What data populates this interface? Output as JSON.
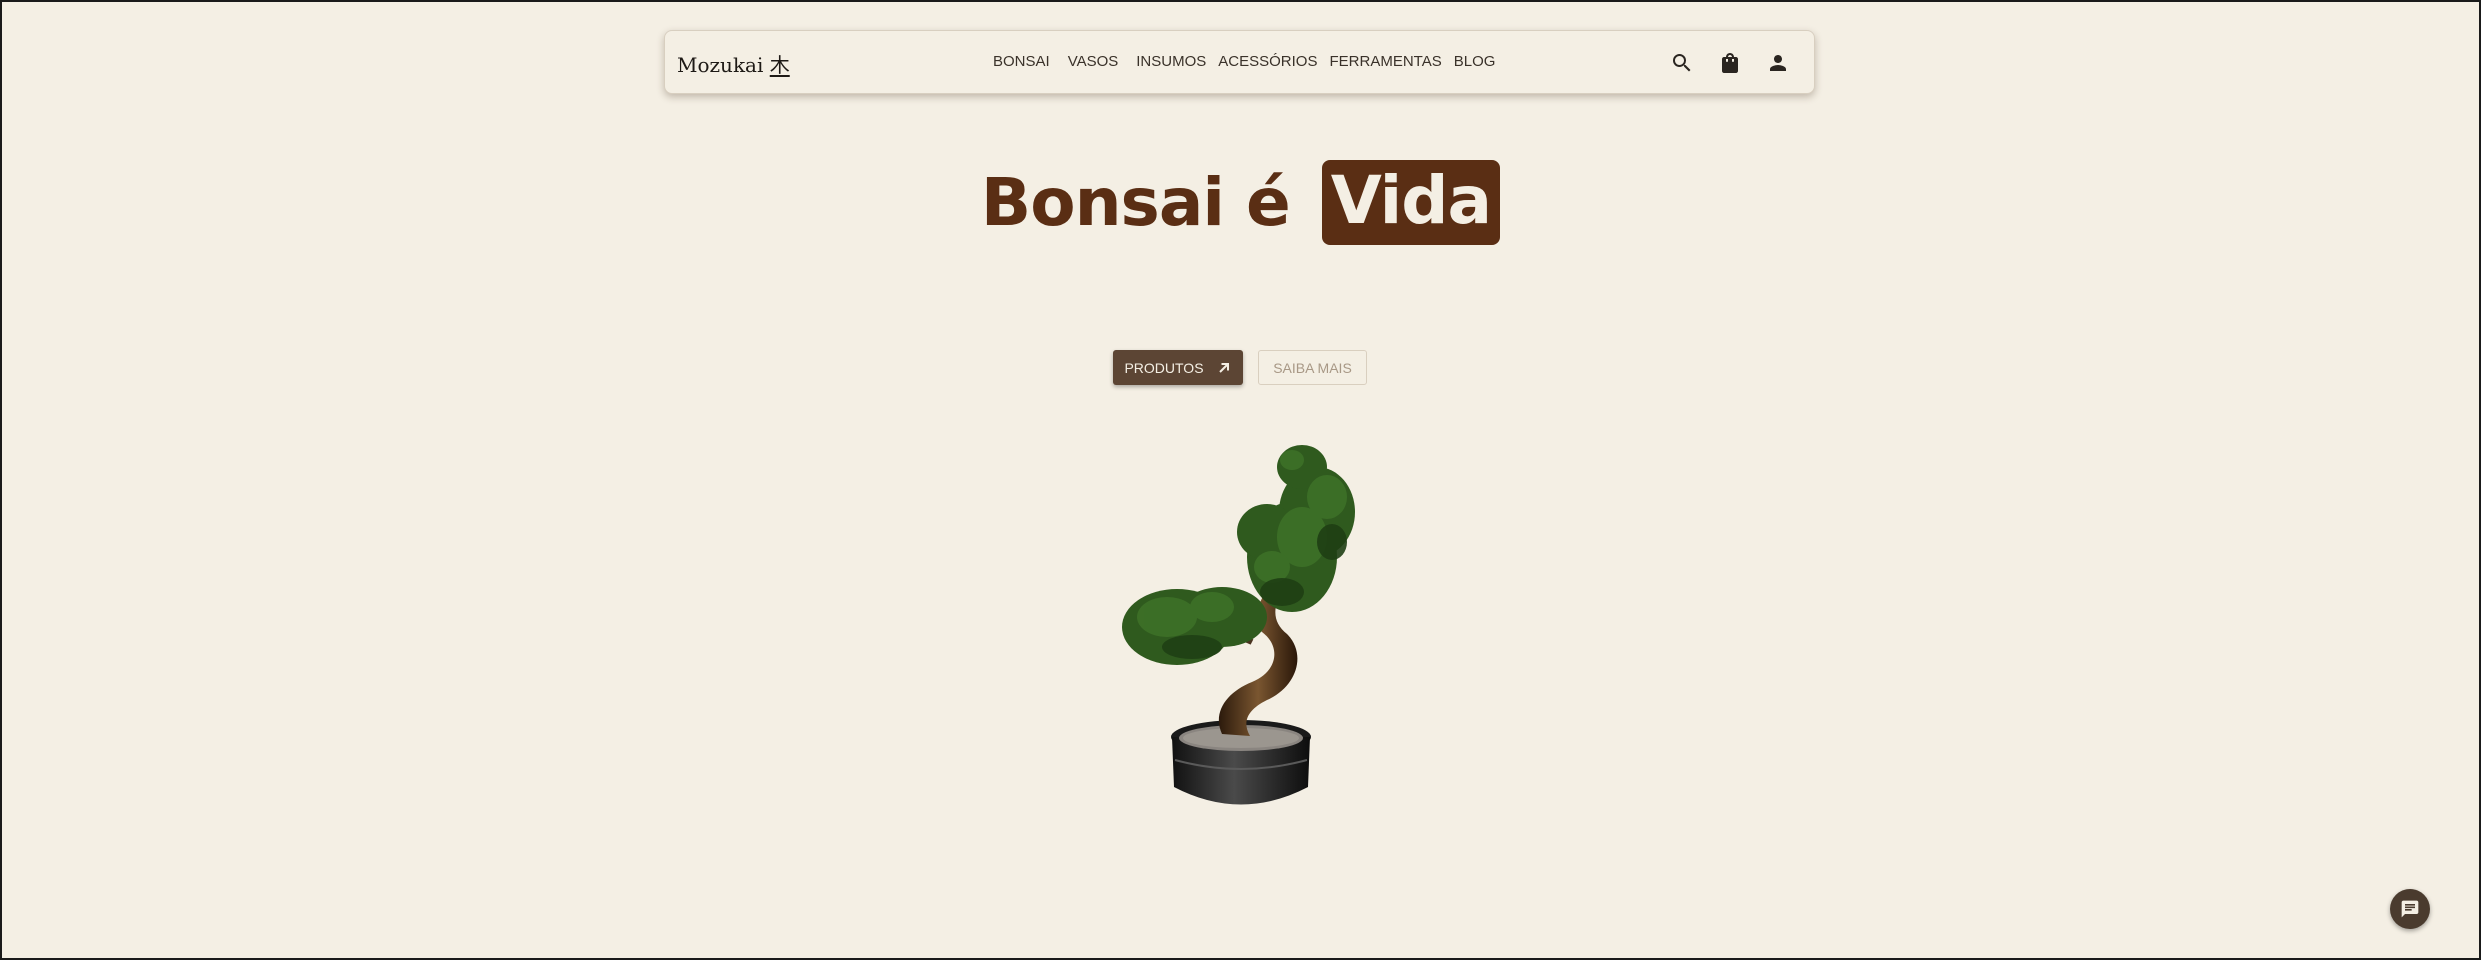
{
  "brand": {
    "name": "Mozukai",
    "kanji": "木"
  },
  "nav": {
    "links": [
      "BONSAI",
      "VASOS",
      "INSUMOS",
      "ACESSÓRIOS",
      "FERRAMENTAS",
      "BLOG"
    ],
    "icons": [
      "search-icon",
      "shopping-bag-icon",
      "user-icon"
    ]
  },
  "hero": {
    "title_prefix": "Bonsai é",
    "title_highlight": "Vida",
    "primary_button": "PRODUTOS",
    "secondary_button": "SAIBA MAIS"
  },
  "colors": {
    "background": "#f4efe4",
    "accent": "#5a2e14",
    "button": "#5c4534",
    "muted": "#a89886"
  },
  "floating": {
    "icon": "chat-icon"
  }
}
